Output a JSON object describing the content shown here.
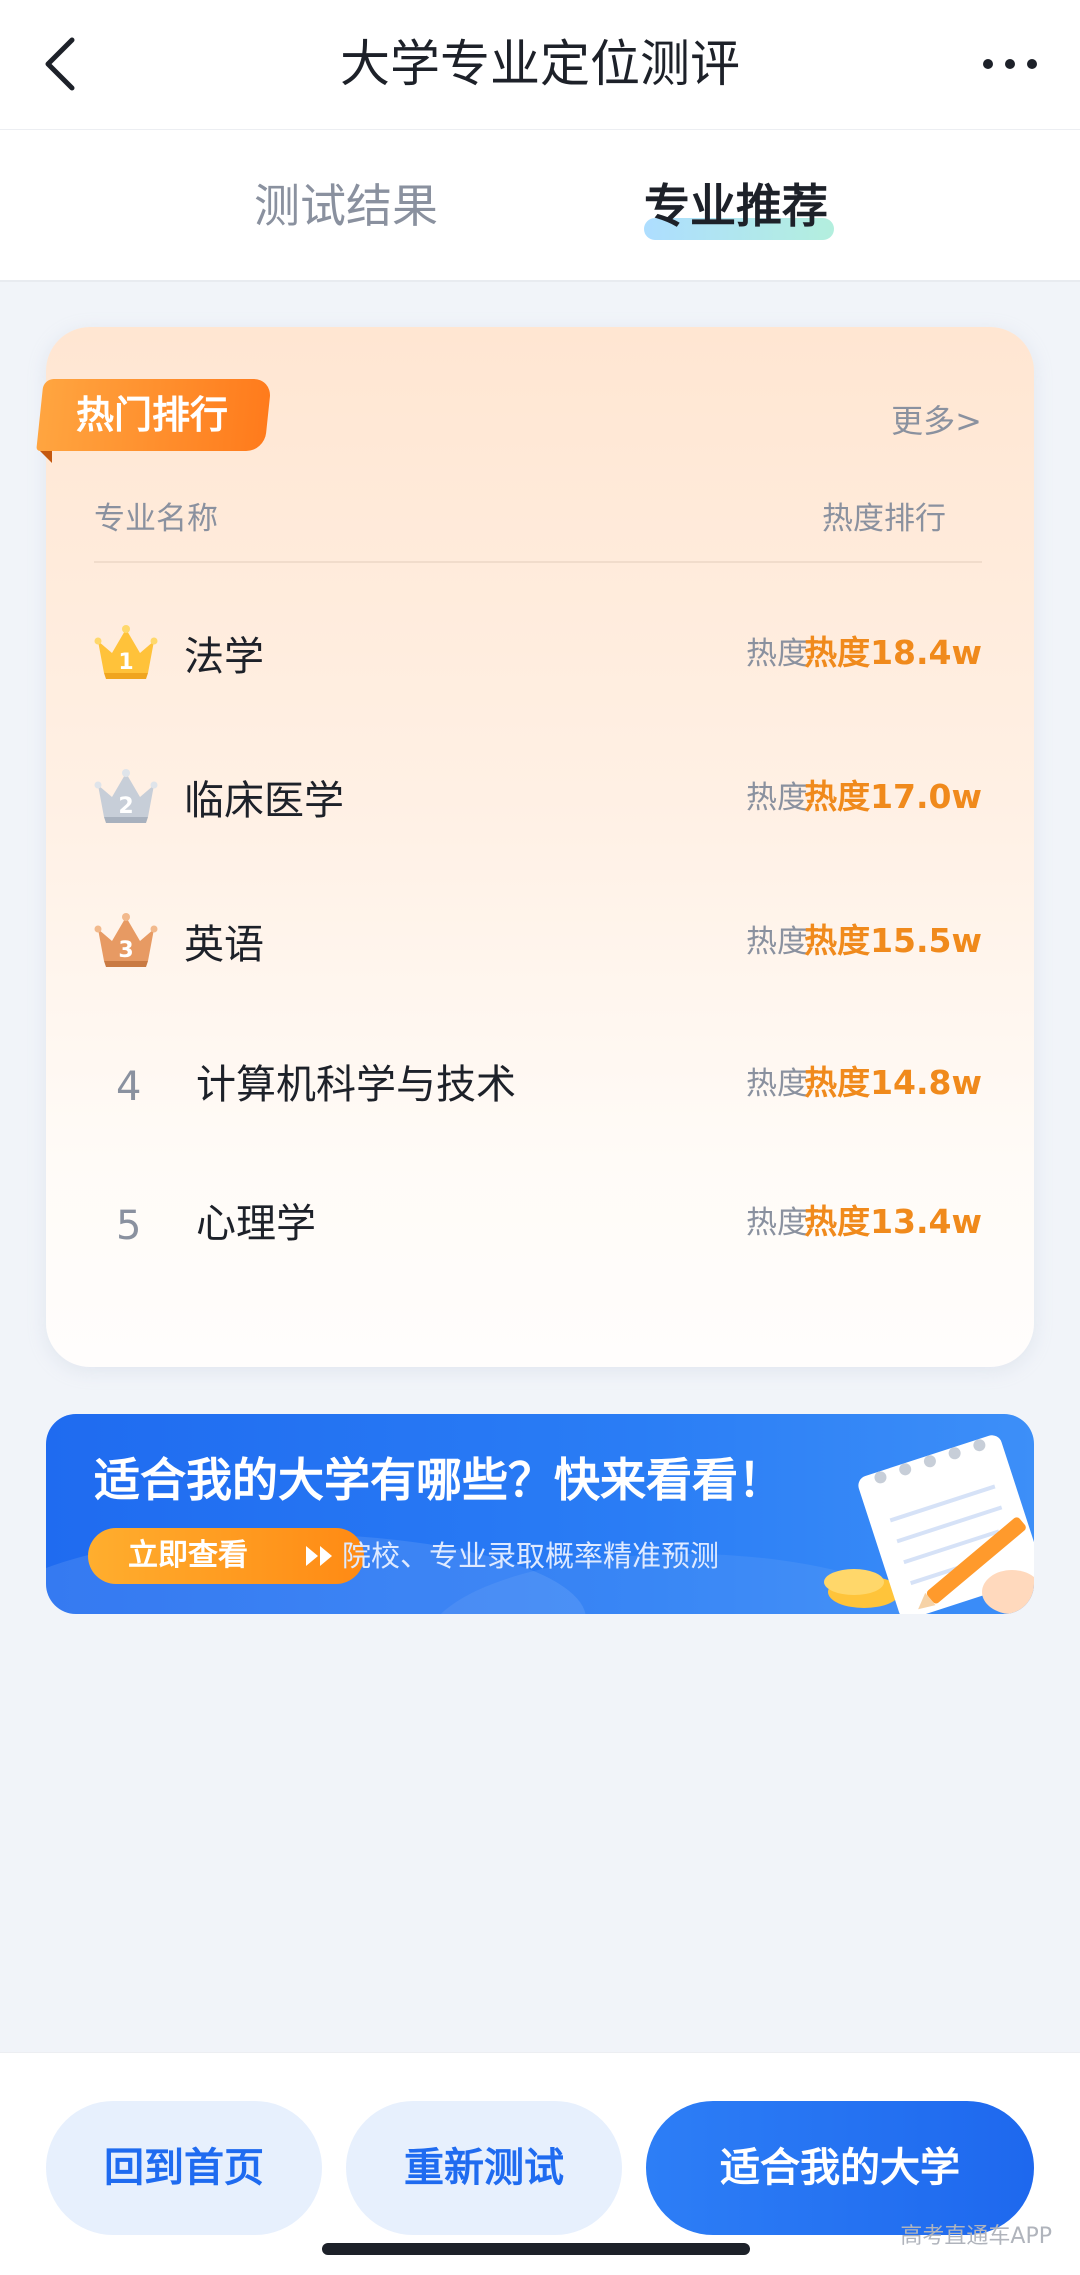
{
  "header": {
    "title": "大学专业定位测评",
    "back_icon": "chevron-left-icon",
    "more_icon": "more-dots-icon"
  },
  "tabs": [
    {
      "label": "测试结果",
      "active": false
    },
    {
      "label": "专业推荐",
      "active": true
    }
  ],
  "ranking": {
    "badge": "热门排行",
    "more": "更多>",
    "col_name": "专业名称",
    "col_rank": "热度排行",
    "items": [
      {
        "rank": "1",
        "name": "法学",
        "heat_label": "热度",
        "heat": "热度18.4w",
        "icon": "gold-crown-icon"
      },
      {
        "rank": "2",
        "name": "临床医学",
        "heat_label": "热度",
        "heat": "热度17.0w",
        "icon": "silver-crown-icon"
      },
      {
        "rank": "3",
        "name": "英语",
        "heat_label": "热度",
        "heat": "热度15.5w",
        "icon": "bronze-crown-icon"
      },
      {
        "rank": "4",
        "name": "计算机科学与技术",
        "heat_label": "热度",
        "heat": "热度14.8w"
      },
      {
        "rank": "5",
        "name": "心理学",
        "heat_label": "热度",
        "heat": "热度13.4w"
      }
    ]
  },
  "banner": {
    "title": "适合我的大学有哪些？快来看看！",
    "button": "立即查看",
    "subtitle": "院校、专业录取概率精准预测"
  },
  "bottom": {
    "home": "回到首页",
    "retest": "重新测试",
    "fit": "适合我的大学"
  },
  "watermark": "高考直通车APP",
  "colors": {
    "accent_blue": "#1f6bf0",
    "heat_orange": "#f08a1c",
    "badge_orange": "#ff8a1c"
  }
}
